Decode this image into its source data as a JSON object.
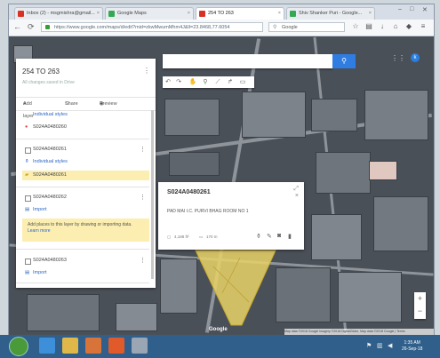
{
  "browser": {
    "tabs": [
      {
        "label": "Inbox (2) - msgmishra@gmail...",
        "active": false,
        "favicon_color": "#d93025"
      },
      {
        "label": "Google Maps",
        "active": false,
        "favicon_color": "#34a853"
      },
      {
        "label": "254 TO 263",
        "active": true,
        "favicon_color": "#d93025"
      },
      {
        "label": "Shiv Shanker Puri - Google...",
        "active": false,
        "favicon_color": "#34a853"
      }
    ],
    "url": "https://www.google.com/maps/d/edit?mid=zkwMwumMhm4J&ll=23.8468,77.6054",
    "search_placeholder": "Google",
    "window_controls": {
      "minimize": "–",
      "maximize": "□",
      "close": "✕"
    }
  },
  "panel": {
    "title": "254 TO 263",
    "subtitle": "All changes saved in Drive",
    "actions": {
      "add_layer": "Add layer",
      "share": "Share",
      "preview": "Preview"
    },
    "layers": [
      {
        "style_link": "Individual styles",
        "item": "S024A0480260"
      },
      {
        "name": "S024A0480261",
        "style_link": "Individual styles",
        "item": "S024A0480261"
      },
      {
        "name": "S024A0480262",
        "import": "Import",
        "hint": "Add places to this layer by drawing or importing data.",
        "hint_link": "Learn more"
      },
      {
        "name": "S024A0480263",
        "import": "Import"
      }
    ]
  },
  "info_window": {
    "title": "S024A0480261",
    "description": "PAD MAI I.C. PURVI BHAG ROOM NO 1",
    "area": "4,188 ft²",
    "perimeter": "170 m"
  },
  "map": {
    "search_button": "search-icon",
    "zoom_in": "+",
    "zoom_out": "−",
    "google_logo": "Google",
    "attribution": "Map data ©2018 Google Imagery ©2018 DigitalGlobe, Map data ©2018 Google | Terms",
    "avatar_initial": "k",
    "polygon_color": "#e8d266"
  },
  "taskbar": {
    "time": "1:35 AM",
    "date": "26-Sep-18"
  }
}
